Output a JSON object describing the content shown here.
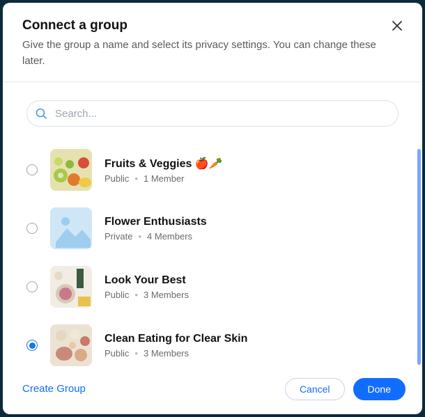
{
  "header": {
    "title": "Connect a group",
    "subtitle": "Give the group a name and select its privacy settings. You can change these later."
  },
  "search": {
    "placeholder": "Search..."
  },
  "groups": [
    {
      "name": "Fruits & Veggies 🍎🥕",
      "privacy": "Public",
      "members": "1 Member",
      "selected": false,
      "thumb": "fruits"
    },
    {
      "name": "Flower Enthusiasts",
      "privacy": "Private",
      "members": "4 Members",
      "selected": false,
      "thumb": "placeholder"
    },
    {
      "name": "Look Your Best",
      "privacy": "Public",
      "members": "3 Members",
      "selected": false,
      "thumb": "beauty"
    },
    {
      "name": "Clean Eating for Clear Skin",
      "privacy": "Public",
      "members": "3 Members",
      "selected": true,
      "thumb": "clean"
    }
  ],
  "footer": {
    "create": "Create Group",
    "cancel": "Cancel",
    "done": "Done"
  },
  "meta_separator": "•"
}
